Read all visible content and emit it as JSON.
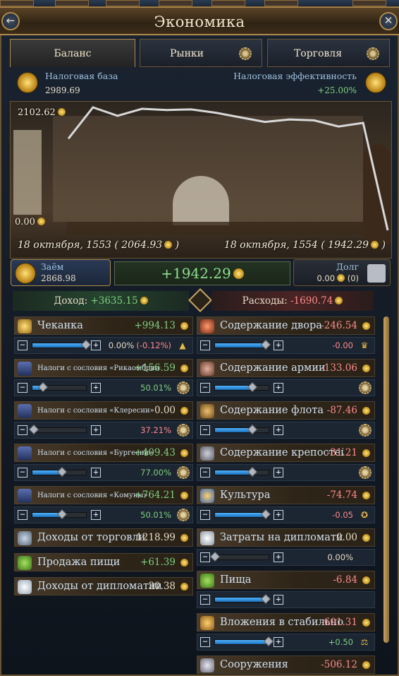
{
  "window": {
    "title": "Экономика"
  },
  "tabs": {
    "balance": "Баланс",
    "markets": "Рынки",
    "trade": "Торговля"
  },
  "tax": {
    "base_label": "Налоговая база",
    "base_value": "2989.69",
    "eff_label": "Налоговая эффективность",
    "eff_value": "+25.00%"
  },
  "chart_data": {
    "type": "line",
    "x": [
      "18 октября, 1553",
      "",
      "",
      "",
      "",
      "",
      "",
      "",
      "",
      "",
      "",
      "",
      "",
      "18 октября, 1554"
    ],
    "values": [
      2000,
      2102.62,
      2075,
      2098,
      2094,
      2096,
      2085,
      2070,
      2055,
      2063,
      2060,
      2040,
      1850,
      1942.29
    ],
    "ylabel_top": "2102.62",
    "ylabel_bottom": "0.00",
    "start_date": "18 октября, 1553",
    "start_value": "( 2064.93",
    "end_date": "18 октября, 1554",
    "end_value": "( 1942.29",
    "close_paren": ")",
    "line_color": "#d8d8d8"
  },
  "loan": {
    "label": "Заём",
    "value": "2868.98"
  },
  "balance": {
    "value": "+1942.29"
  },
  "debt": {
    "label": "Долг",
    "value": "0.00",
    "count": "(0)"
  },
  "income": {
    "label": "Доход:",
    "value": "+3635.15"
  },
  "expenses": {
    "label": "Расходы:",
    "value": "-1690.74"
  },
  "income_rows": [
    {
      "name": "Чеканка",
      "value": "+994.13",
      "pct": "0.00%",
      "pct_extra": "(-0.12%)"
    },
    {
      "name": "Налоги с сословия «Рикаомбрии»",
      "value": "+156.59",
      "pct": "50.01%"
    },
    {
      "name": "Налоги с сословия «Клересии»",
      "value": "0.00",
      "pct": "37.21%"
    },
    {
      "name": "Налоги с сословия «Бургесии»",
      "value": "+409.43",
      "pct": "77.00%"
    },
    {
      "name": "Налоги с сословия «Комуны»",
      "value": "+764.21",
      "pct": "50.01%"
    },
    {
      "name": "Доходы от торговли",
      "value": "1218.99"
    },
    {
      "name": "Продажа пищи",
      "value": "+61.39"
    },
    {
      "name": "Доходы от дипломатии",
      "value": "30.38"
    }
  ],
  "expense_rows": [
    {
      "name": "Содержание двора",
      "value": "-246.54",
      "pct": "-0.00"
    },
    {
      "name": "Содержание армии",
      "value": "-133.06"
    },
    {
      "name": "Содержание флота",
      "value": "-87.46"
    },
    {
      "name": "Содержание крепостей",
      "value": "-31.21"
    },
    {
      "name": "Культура",
      "value": "-74.74",
      "pct": "-0.05"
    },
    {
      "name": "Затраты на дипломатию",
      "value": "0.00",
      "pct": "0.00%"
    },
    {
      "name": "Пища",
      "value": "-6.84"
    },
    {
      "name": "Вложения в стабильность",
      "value": "-601.31",
      "pct": "+0.50"
    },
    {
      "name": "Сооружения",
      "value": "-506.12"
    }
  ],
  "sliders": {
    "inc_0": 1.0,
    "inc_1": 0.2,
    "inc_2": 0.03,
    "inc_3": 0.55,
    "inc_4": 0.55,
    "exp_0": 0.95,
    "exp_1": 0.7,
    "exp_2": 0.7,
    "exp_3": 0.7,
    "exp_4": 0.95,
    "exp_5": 0.0,
    "exp_6": 0.95,
    "exp_7": 1.0
  }
}
